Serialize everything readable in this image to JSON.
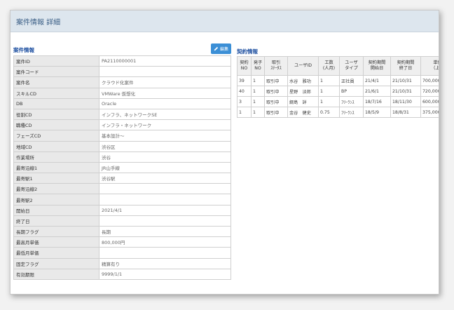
{
  "page": {
    "title": "案件情報 詳細"
  },
  "case_info": {
    "title": "案件情報",
    "edit_label": "編集",
    "rows": [
      {
        "label": "案件ID",
        "value": "PA2110000001"
      },
      {
        "label": "案件コード",
        "value": ""
      },
      {
        "label": "案件名",
        "value": "クラウド化案件"
      },
      {
        "label": "スキルCD",
        "value": "VMWare 仮想化"
      },
      {
        "label": "DB",
        "value": "Oracle"
      },
      {
        "label": "役割CD",
        "value": "インフラ、ネットワークSE"
      },
      {
        "label": "職種CD",
        "value": "インフラ・ネットワーク"
      },
      {
        "label": "フェーズCD",
        "value": "基本設計～"
      },
      {
        "label": "地域CD",
        "value": "渋谷区"
      },
      {
        "label": "作業場所",
        "value": "渋谷"
      },
      {
        "label": "最寄沿線1",
        "value": "JR山手線"
      },
      {
        "label": "最寄駅1",
        "value": "渋谷駅"
      },
      {
        "label": "最寄沿線2",
        "value": ""
      },
      {
        "label": "最寄駅2",
        "value": ""
      },
      {
        "label": "開始日",
        "value": "2021/4/1"
      },
      {
        "label": "終了日",
        "value": ""
      },
      {
        "label": "長期フラグ",
        "value": "長期"
      },
      {
        "label": "最高月単価",
        "value": "800,000円"
      },
      {
        "label": "最低月単価",
        "value": ""
      },
      {
        "label": "固定フラグ",
        "value": "精算有り"
      },
      {
        "label": "有効期限",
        "value": "9999/1/1"
      }
    ]
  },
  "contracts": {
    "title": "契約情報",
    "headers": [
      {
        "l1": "契約",
        "l2": "NO"
      },
      {
        "l1": "発子",
        "l2": "NO"
      },
      {
        "l1": "取引",
        "l2": "ｽﾃｰﾀｽ"
      },
      {
        "l1": "ユーザID",
        "l2": ""
      },
      {
        "l1": "工数",
        "l2": "(人月)"
      },
      {
        "l1": "ユーザ",
        "l2": "タイプ"
      },
      {
        "l1": "契約期間",
        "l2": "開始日"
      },
      {
        "l1": "契約期間",
        "l2": "終了日"
      },
      {
        "l1": "単価",
        "l2": "（上位"
      }
    ],
    "rows": [
      {
        "no": "39",
        "sub": "1",
        "status": "取引中",
        "user": "水谷　雅功",
        "effort": "1",
        "type": "正社員",
        "start": "21/4/1",
        "end": "21/10/31",
        "price": "700,000"
      },
      {
        "no": "40",
        "sub": "1",
        "status": "取引中",
        "user": "星野　淡郎",
        "effort": "1",
        "type": "BP",
        "start": "21/6/1",
        "end": "21/10/31",
        "price": "720,000"
      },
      {
        "no": "3",
        "sub": "1",
        "status": "取引中",
        "user": "綱島　詳",
        "effort": "1",
        "type": "ﾌﾘｰﾗﾝｽ",
        "start": "18/7/16",
        "end": "18/11/30",
        "price": "600,000"
      },
      {
        "no": "1",
        "sub": "1",
        "status": "取引中",
        "user": "金谷　健史",
        "effort": "0.75",
        "type": "ﾌﾘｰﾗﾝｽ",
        "start": "18/5/9",
        "end": "18/8/31",
        "price": "375,000"
      }
    ]
  }
}
